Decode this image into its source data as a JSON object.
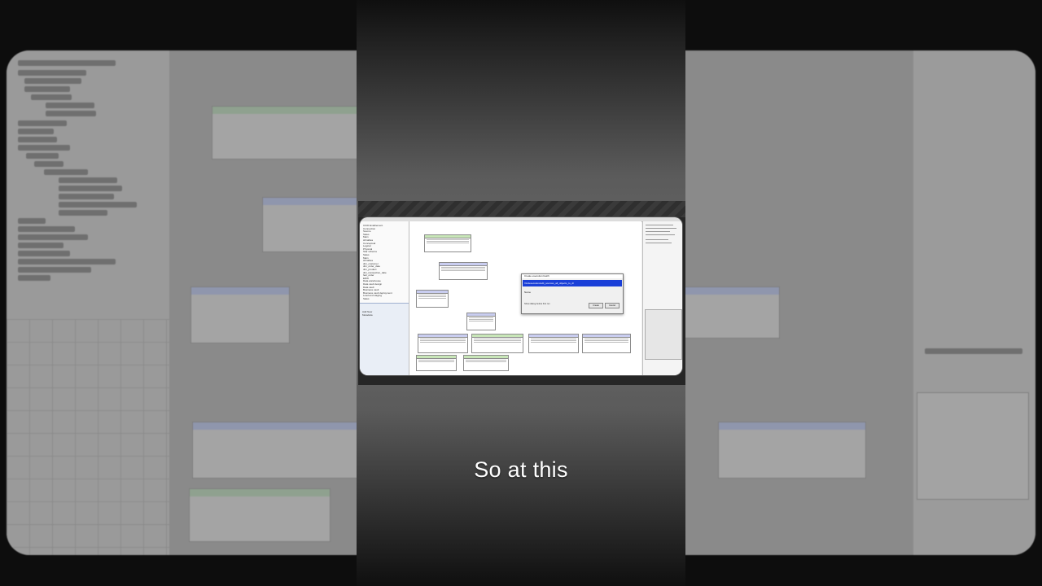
{
  "bg": {
    "tree_items": [
      "CICD Enablement",
      "Connection",
      "Source",
      "Sales",
      "Main",
      "Sales Fact",
      "All tables",
      "Conceptual",
      "Logical",
      "Physical",
      "Star schema",
      "Sales",
      "Main",
      "All tables",
      "dim_customer",
      "dim_order_date",
      "dim_product",
      "dim_transaction_date",
      "fact_order",
      "EDW",
      "Data warehouse",
      "Data vault design",
      "Data vault",
      "Business vault",
      "Business vault deployment",
      "Load and staging",
      "Sales"
    ]
  },
  "app": {
    "left_tree": [
      "CICD Enablement",
      "Connection",
      "Source",
      "Sales",
      "Main",
      "All tables",
      "Conceptual",
      "Logical",
      "Physical",
      "Star schema",
      "Sales",
      "Main",
      "All tables",
      "dim_customer",
      "dim_order_date",
      "dim_product",
      "dim_transaction_date",
      "fact_order",
      "EDW",
      "Data warehouse",
      "Data vault design",
      "Data vault",
      "Business vault",
      "Business vault deployment",
      "Load and staging",
      "Sales"
    ],
    "add_new_label": "Add New Metadata",
    "dialog": {
      "title": "Create execution batch",
      "band": "Vindexecution/edit_sources_all_objects_to_dl",
      "body": "Name",
      "checkbox": "Show dialog before first run",
      "ok": "Create",
      "cancel": "Cancel"
    }
  },
  "caption": "So at this"
}
